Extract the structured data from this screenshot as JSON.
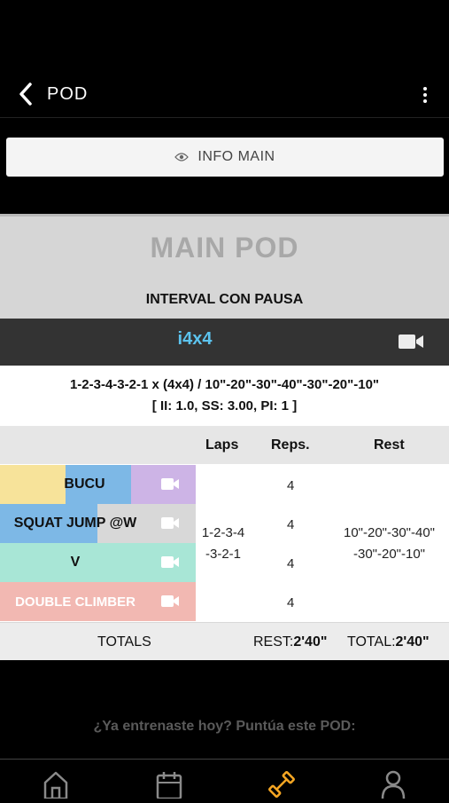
{
  "header": {
    "title": "POD"
  },
  "info_button": {
    "label": "INFO MAIN"
  },
  "pod": {
    "title": "MAIN POD",
    "subtitle": "INTERVAL CON PAUSA",
    "workout_name": "i4x4",
    "scheme_line1": "1-2-3-4-3-2-1 x (4x4) / 10\"-20\"-30\"-40\"-30\"-20\"-10\"",
    "scheme_line2": "[ II: 1.0, SS: 3.00, PI: 1 ]"
  },
  "table": {
    "headers": {
      "laps": "Laps",
      "reps": "Reps.",
      "rest": "Rest"
    },
    "exercises": [
      {
        "name": "BUCU",
        "reps": "4",
        "colors": [
          "#f7e39a",
          "#7db8e6",
          "#cdb4e6"
        ]
      },
      {
        "name": "SQUAT JUMP @W",
        "reps": "4",
        "colors": [
          "#7db8e6",
          "#d8d8d8"
        ]
      },
      {
        "name": "V",
        "reps": "4",
        "colors": [
          "#a8e6d6"
        ]
      },
      {
        "name": "DOUBLE CLIMBER",
        "reps": "4",
        "colors": [
          "#f2b8b2"
        ]
      }
    ],
    "laps_line1": "1-2-3-4",
    "laps_line2": "-3-2-1",
    "rest_line1": "10\"-20\"-30\"-40\"",
    "rest_line2": "-30\"-20\"-10\""
  },
  "totals": {
    "label": "TOTALS",
    "rest_label": "REST:",
    "rest_value": "2'40\"",
    "total_label": "TOTAL:",
    "total_value": "2'40\""
  },
  "rating_prompt": "¿Ya entrenaste hoy? Puntúa este POD:",
  "tabs": [
    {
      "icon": "home-icon"
    },
    {
      "icon": "calendar-icon"
    },
    {
      "icon": "dumbbell-icon",
      "active": true,
      "color": "#f5a623"
    },
    {
      "icon": "profile-icon"
    }
  ]
}
